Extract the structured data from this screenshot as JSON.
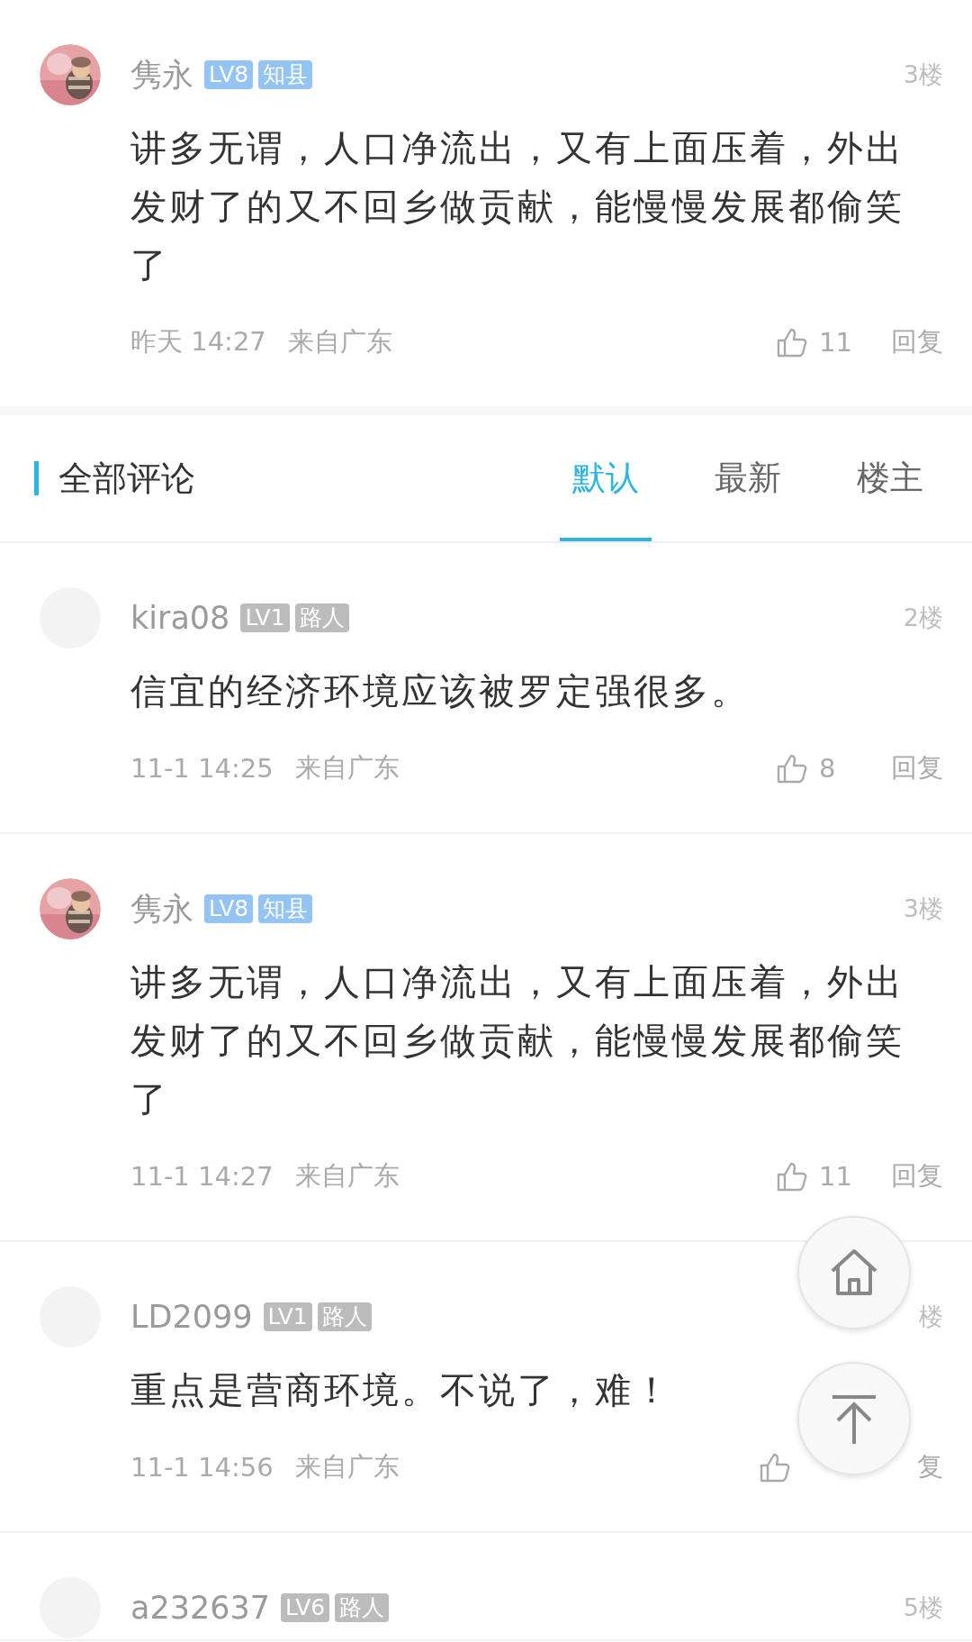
{
  "pinned_comment": {
    "user": {
      "name": "隽永",
      "badges": [
        {
          "text": "LV8",
          "color": "#93c4f3"
        },
        {
          "text": "知县",
          "color": "#93c4f3"
        }
      ]
    },
    "floor": "3楼",
    "content": "讲多无谓，人口净流出，又有上面压着，外出发财了的又不回乡做贡献，能慢慢发展都偷笑了",
    "time": "昨天 14:27",
    "location": "来自广东",
    "likes": "11",
    "reply": "回复"
  },
  "section": {
    "title": "全部评论",
    "tabs": [
      {
        "label": "默认",
        "selected": true
      },
      {
        "label": "最新",
        "selected": false
      },
      {
        "label": "楼主",
        "selected": false
      }
    ]
  },
  "comments": [
    {
      "user": {
        "name": "kira08",
        "avatar": {
          "kind": "empty"
        },
        "badges": [
          {
            "text": "LV1",
            "color": "#bcbcbc"
          },
          {
            "text": "路人",
            "color": "#bcbcbc"
          }
        ]
      },
      "floor": "2楼",
      "content": "信宜的经济环境应该被罗定强很多。",
      "time": "11-1 14:25",
      "location": "来自广东",
      "likes": "8",
      "reply": "回复"
    },
    {
      "user": {
        "name": "隽永",
        "badges": [
          {
            "text": "LV8",
            "color": "#93c4f3"
          },
          {
            "text": "知县",
            "color": "#93c4f3"
          }
        ]
      },
      "floor": "3楼",
      "content": "讲多无谓，人口净流出，又有上面压着，外出发财了的又不回乡做贡献，能慢慢发展都偷笑了",
      "time": "11-1 14:27",
      "location": "来自广东",
      "likes": "11",
      "reply": "回复"
    },
    {
      "user": {
        "name": "LD2099",
        "avatar": {
          "kind": "empty"
        },
        "badges": [
          {
            "text": "LV1",
            "color": "#bcbcbc"
          },
          {
            "text": "路人",
            "color": "#bcbcbc"
          }
        ]
      },
      "floor": "楼",
      "content": "重点是营商环境。不说了，难！",
      "time": "11-1 14:56",
      "location": "来自广东",
      "reply": "复"
    },
    {
      "user": {
        "name": "a232637",
        "avatar": {
          "kind": "empty"
        },
        "badges": [
          {
            "text": "LV6",
            "color": "#bcbcbc"
          },
          {
            "text": "路人",
            "color": "#bcbcbc"
          }
        ]
      },
      "floor": "5楼"
    }
  ]
}
